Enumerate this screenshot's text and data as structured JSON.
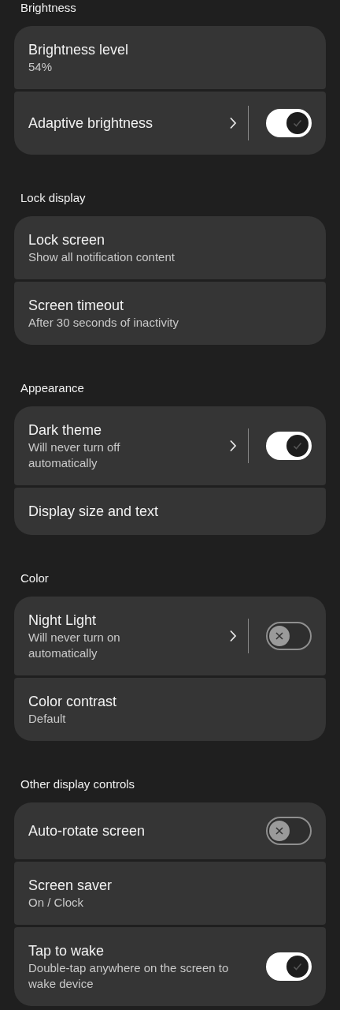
{
  "sections": [
    {
      "title": "Brightness",
      "items": [
        {
          "title": "Brightness level",
          "subtitle": "54%"
        },
        {
          "title": "Adaptive brightness",
          "chevron": true,
          "switch": {
            "on": true
          }
        }
      ]
    },
    {
      "title": "Lock display",
      "items": [
        {
          "title": "Lock screen",
          "subtitle": "Show all notification content"
        },
        {
          "title": "Screen timeout",
          "subtitle": "After 30 seconds of inactivity"
        }
      ]
    },
    {
      "title": "Appearance",
      "items": [
        {
          "title": "Dark theme",
          "subtitle": "Will never turn off automatically",
          "chevron": true,
          "switch": {
            "on": true
          }
        },
        {
          "title": "Display size and text"
        }
      ]
    },
    {
      "title": "Color",
      "items": [
        {
          "title": "Night Light",
          "subtitle": "Will never turn on automatically",
          "chevron": true,
          "switch": {
            "on": false
          }
        },
        {
          "title": "Color contrast",
          "subtitle": "Default"
        }
      ]
    },
    {
      "title": "Other display controls",
      "items": [
        {
          "title": "Auto-rotate screen",
          "switch": {
            "on": false
          }
        },
        {
          "title": "Screen saver",
          "subtitle": "On / Clock"
        },
        {
          "title": "Tap to wake",
          "subtitle": "Double-tap anywhere on the screen to wake device",
          "switch": {
            "on": true
          }
        }
      ]
    }
  ]
}
